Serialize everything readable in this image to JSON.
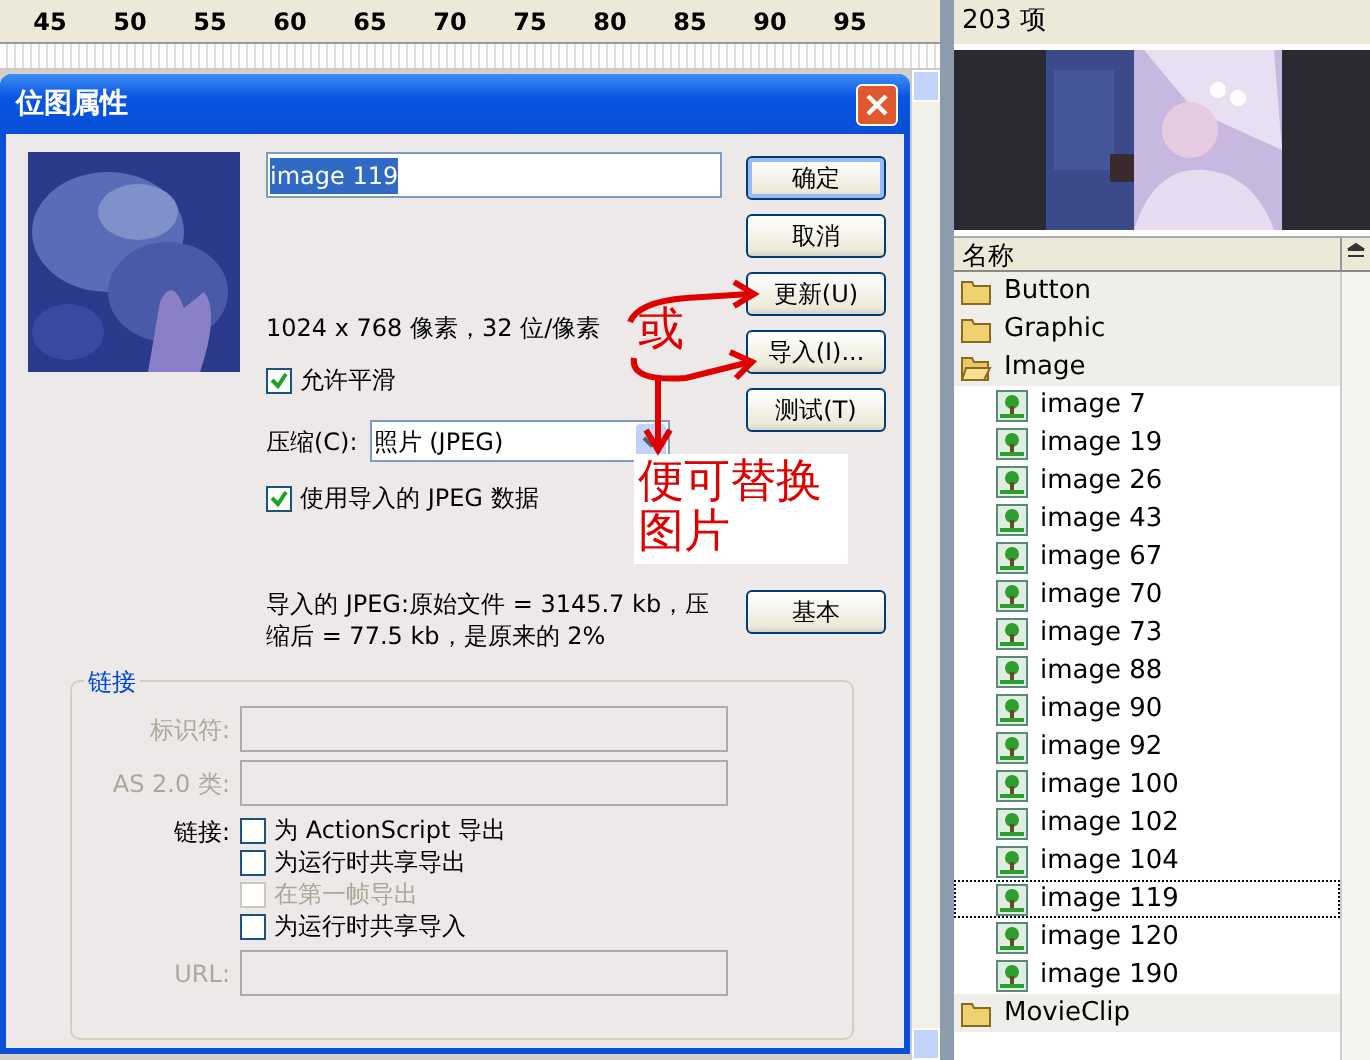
{
  "ruler": {
    "ticks": [
      "45",
      "50",
      "55",
      "60",
      "65",
      "70",
      "75",
      "80",
      "85",
      "90",
      "95"
    ]
  },
  "dialog": {
    "title": "位图属性",
    "name_field": {
      "value": "image 119",
      "text_selected": true
    },
    "info": "1024 x 768 像素，32 位/像素",
    "smoothing": {
      "label": "允许平滑",
      "checked": true
    },
    "compression": {
      "label": "压缩(C):",
      "value": "照片 (JPEG)"
    },
    "use_jpeg": {
      "label": "使用导入的 JPEG 数据",
      "checked": true
    },
    "import_info": "导入的 JPEG:原始文件 = 3145.7 kb，压缩后 = 77.5 kb，是原来的 2%",
    "buttons": [
      {
        "label": "确定",
        "kind": "default"
      },
      {
        "label": "取消",
        "kind": "normal"
      },
      {
        "label": "更新(U)",
        "kind": "normal"
      },
      {
        "label": "导入(I)...",
        "kind": "normal"
      },
      {
        "label": "测试(T)",
        "kind": "normal"
      }
    ],
    "basic_button": "基本",
    "linkage": {
      "title": "链接",
      "fields": [
        {
          "label": "标识符:",
          "disabled": true
        },
        {
          "label": "AS 2.0 类:",
          "disabled": true
        }
      ],
      "linkage_label": "链接:",
      "options": [
        {
          "label": "为 ActionScript 导出",
          "checked": false,
          "disabled": false
        },
        {
          "label": "为运行时共享导出",
          "checked": false,
          "disabled": false
        },
        {
          "label": "在第一帧导出",
          "checked": false,
          "disabled": true
        },
        {
          "label": "为运行时共享导入",
          "checked": false,
          "disabled": false
        }
      ],
      "url": {
        "label": "URL:",
        "disabled": true
      }
    }
  },
  "annotations": [
    {
      "text": "或"
    },
    {
      "text": "便可替换图片"
    }
  ],
  "library": {
    "count": "203 项",
    "column": "名称",
    "items": [
      {
        "name": "Button",
        "kind": "folder",
        "expanded": false
      },
      {
        "name": "Graphic",
        "kind": "folder",
        "expanded": false
      },
      {
        "name": "Image",
        "kind": "folder",
        "expanded": true,
        "children": [
          {
            "name": "image 7",
            "kind": "bitmap",
            "selected": false
          },
          {
            "name": "image 19",
            "kind": "bitmap",
            "selected": false
          },
          {
            "name": "image 26",
            "kind": "bitmap",
            "selected": false
          },
          {
            "name": "image 43",
            "kind": "bitmap",
            "selected": false
          },
          {
            "name": "image 67",
            "kind": "bitmap",
            "selected": false
          },
          {
            "name": "image 70",
            "kind": "bitmap",
            "selected": false
          },
          {
            "name": "image 73",
            "kind": "bitmap",
            "selected": false
          },
          {
            "name": "image 88",
            "kind": "bitmap",
            "selected": false
          },
          {
            "name": "image 90",
            "kind": "bitmap",
            "selected": false
          },
          {
            "name": "image 92",
            "kind": "bitmap",
            "selected": false
          },
          {
            "name": "image 100",
            "kind": "bitmap",
            "selected": false
          },
          {
            "name": "image 102",
            "kind": "bitmap",
            "selected": false
          },
          {
            "name": "image 104",
            "kind": "bitmap",
            "selected": false
          },
          {
            "name": "image 119",
            "kind": "bitmap",
            "selected": true
          },
          {
            "name": "image 120",
            "kind": "bitmap",
            "selected": false
          },
          {
            "name": "image 190",
            "kind": "bitmap",
            "selected": false
          }
        ]
      },
      {
        "name": "MovieClip",
        "kind": "folder",
        "expanded": false
      }
    ]
  }
}
